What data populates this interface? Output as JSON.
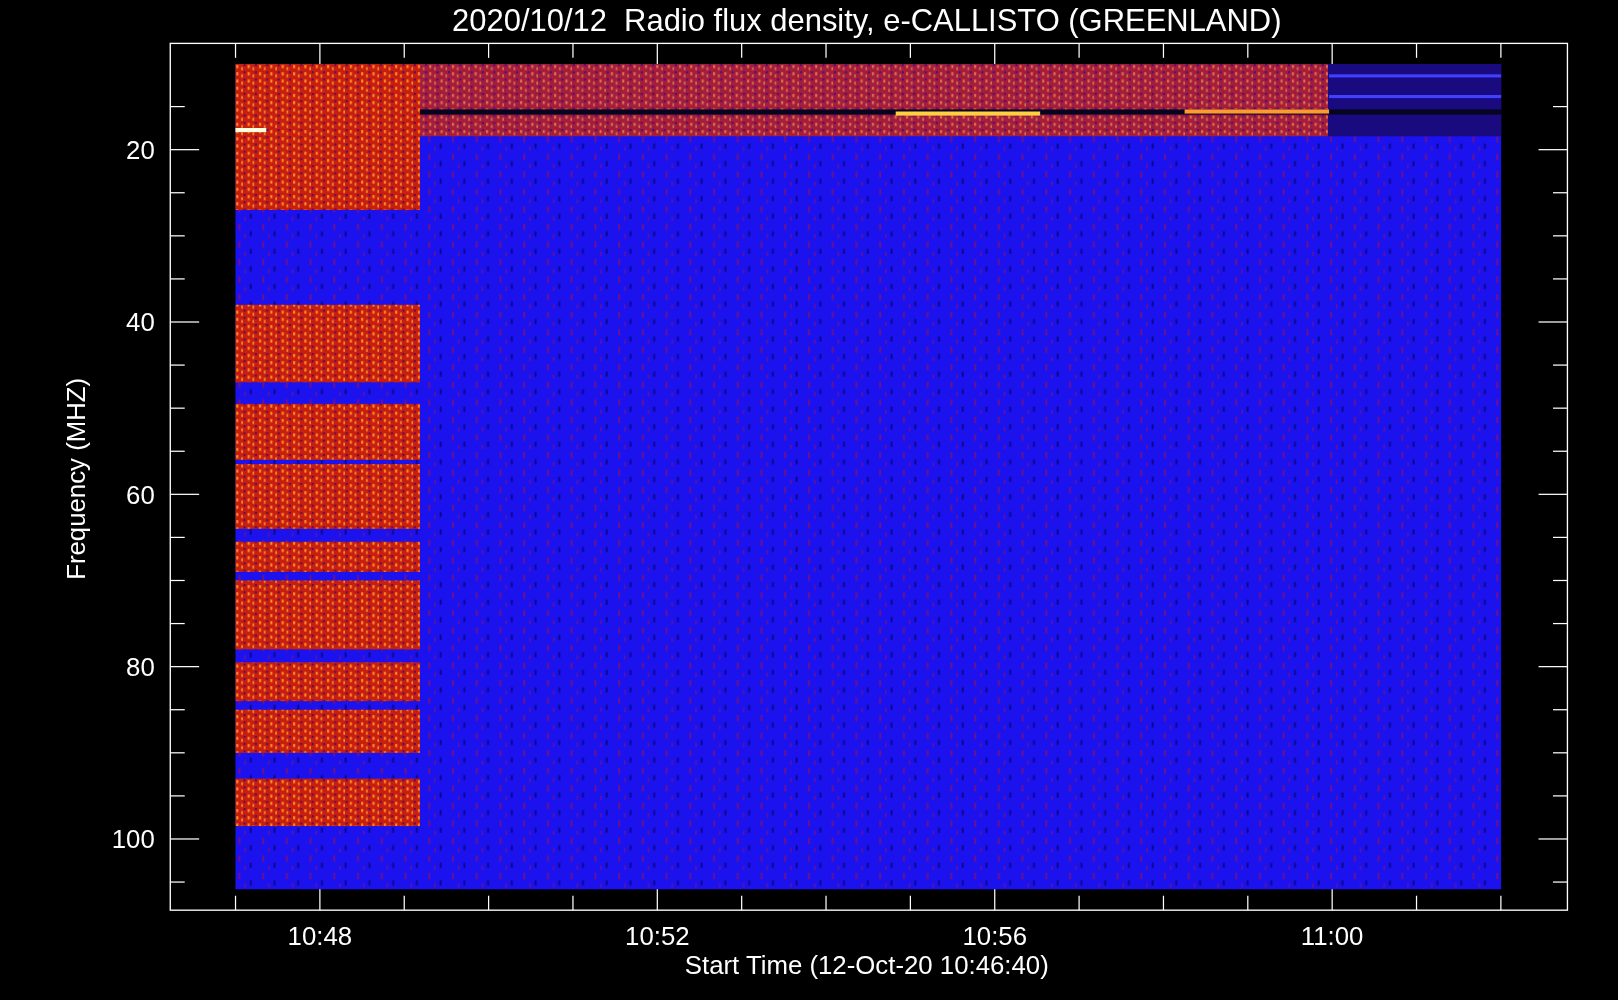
{
  "title": "2020/10/12  Radio flux density, e-CALLISTO (GREENLAND)",
  "y_axis": {
    "label": "Frequency (MHZ)",
    "ticks": [
      "20",
      "40",
      "60",
      "80",
      "100"
    ]
  },
  "x_axis": {
    "label": "Start Time (12-Oct-20 10:46:40)",
    "ticks": [
      "10:48",
      "10:52",
      "10:56",
      "11:00"
    ]
  }
}
